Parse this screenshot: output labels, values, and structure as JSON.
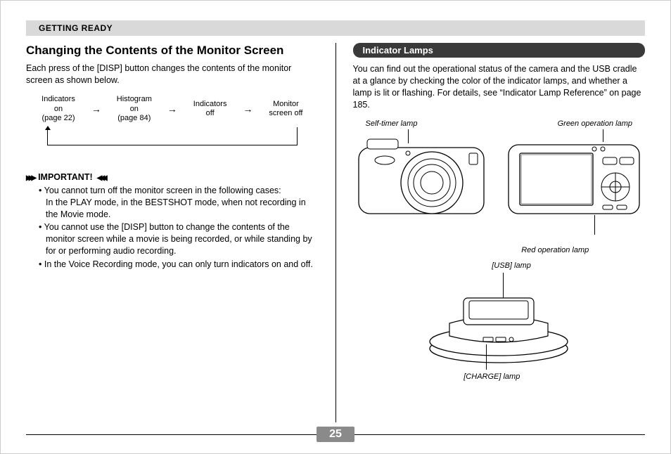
{
  "header": {
    "section": "GETTING READY"
  },
  "pageNumber": "25",
  "left": {
    "heading": "Changing the Contents of the Monitor Screen",
    "intro": "Each press of the [DISP] button changes the contents of the monitor screen as shown below.",
    "flow": {
      "items": [
        "Indicators\non\n(page 22)",
        "Histogram\non\n(page 84)",
        "Indicators\noff",
        "Monitor\nscreen off"
      ]
    },
    "importantLabel": "IMPORTANT!",
    "important": [
      "You cannot turn off the monitor screen in the following cases:\nIn the PLAY mode, in the BESTSHOT mode, when not recording in the Movie mode.",
      "You cannot use the [DISP] button to change the contents of the monitor screen while a movie is being recorded, or while standing by for or performing audio recording.",
      "In the Voice Recording mode, you can only turn indicators on and off."
    ]
  },
  "right": {
    "pill": "Indicator Lamps",
    "intro": "You can find out the operational status of the camera and the USB cradle at a glance by checking the color of the indicator lamps, and whether a lamp is lit or flashing. For details, see “Indicator Lamp Reference” on page 185.",
    "labels": {
      "selfTimer": "Self-timer lamp",
      "greenOp": "Green operation lamp",
      "redOp": "Red operation lamp",
      "usb": "[USB] lamp",
      "charge": "[CHARGE] lamp"
    }
  }
}
